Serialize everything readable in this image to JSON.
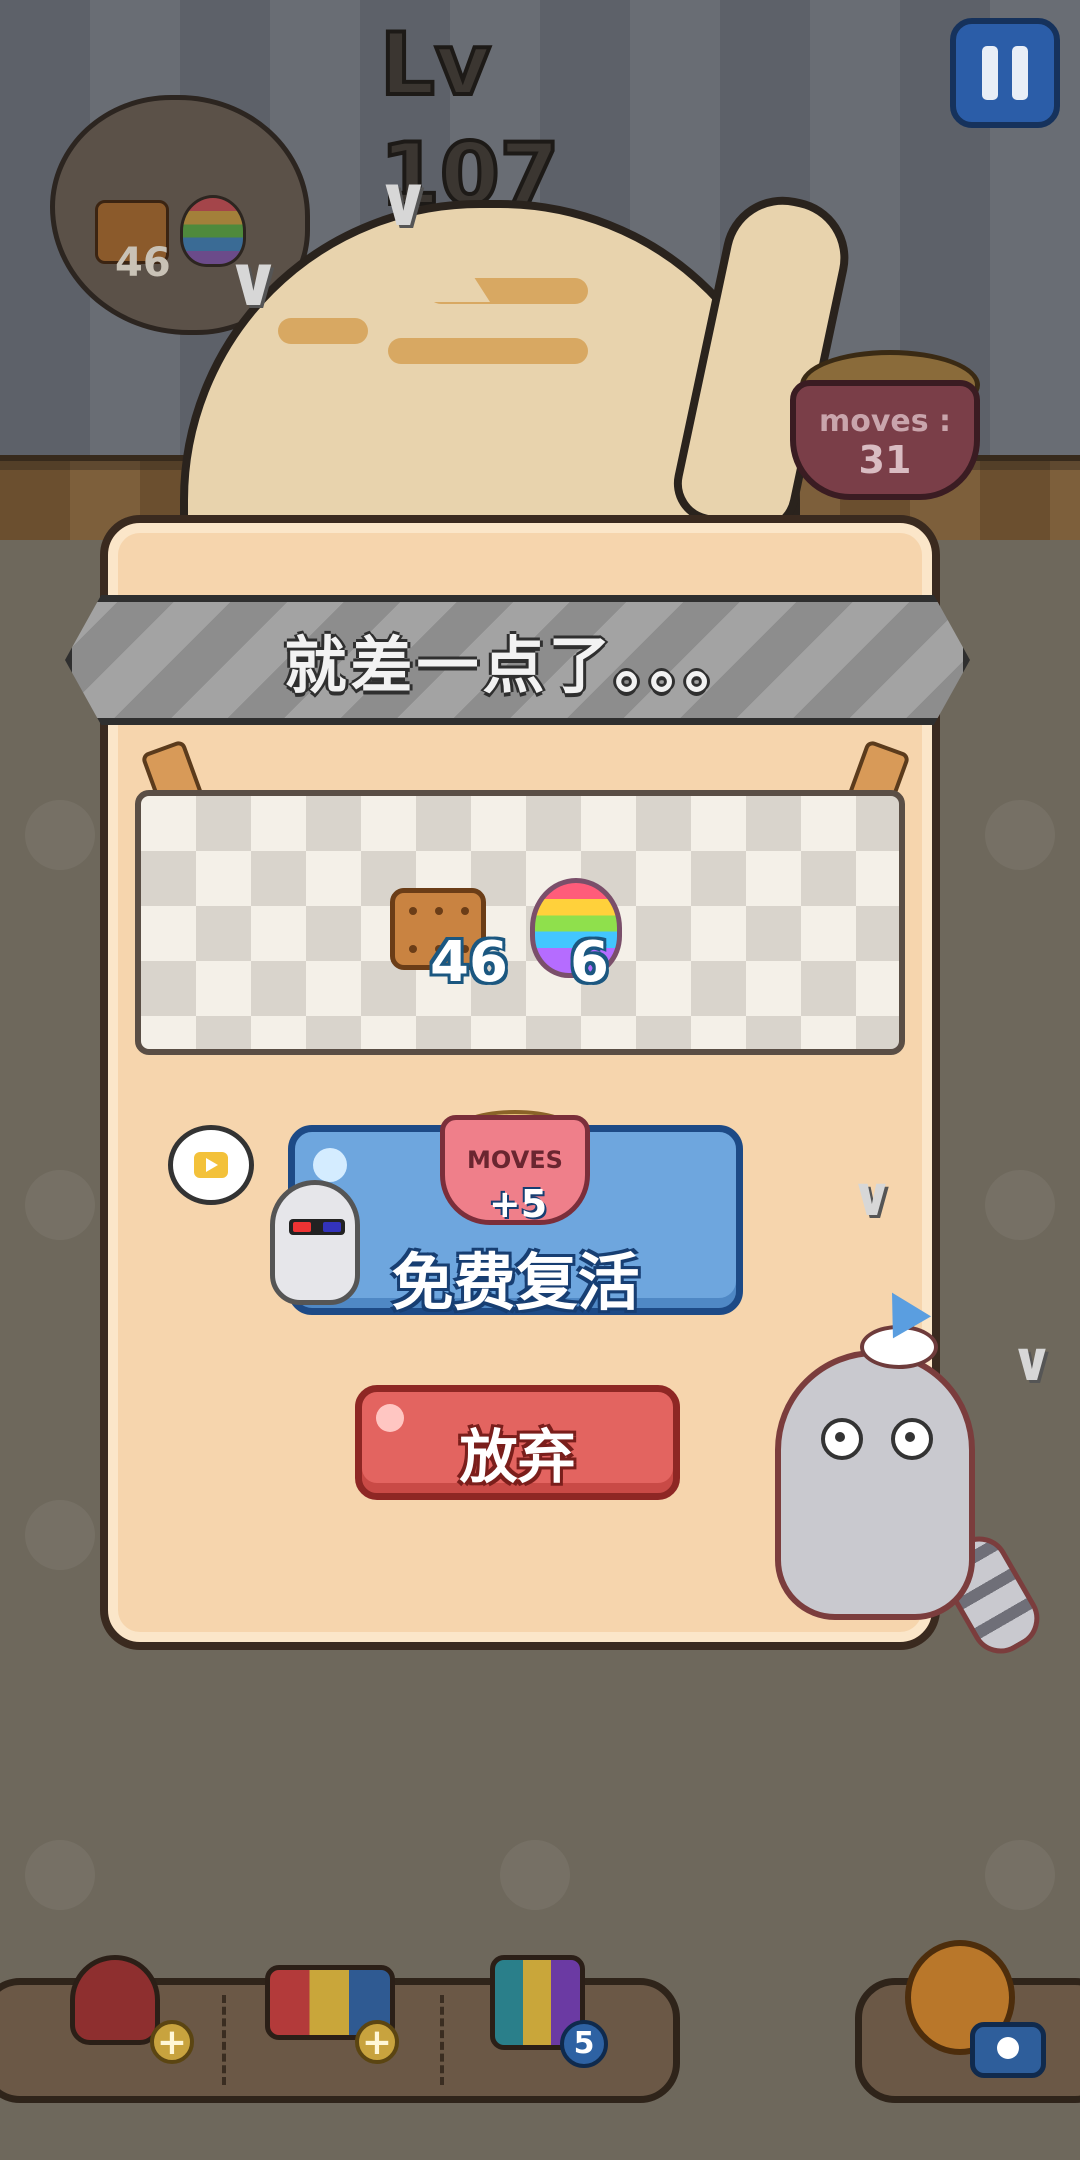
{
  "hud": {
    "level": "Lv 107",
    "pause_icon": "pause-icon",
    "thought_goal_count": "46"
  },
  "background": {
    "food_bowl_label": "moves :",
    "moves_left": "31"
  },
  "dialog": {
    "title": "就差一点了。。。",
    "goals": [
      {
        "icon": "biscuit-icon",
        "count": "46"
      },
      {
        "icon": "rainbow-jelly-icon",
        "count": "6"
      }
    ],
    "revive": {
      "bowl_label": "MOVES",
      "bonus": "+5",
      "label": "免费复活",
      "ad_icon": "video-ad-icon"
    },
    "give_up_label": "放弃"
  },
  "tools": [
    {
      "icon": "hammer-tool-icon",
      "badge": "+"
    },
    {
      "icon": "paint-roller-tool-icon",
      "badge": "+"
    },
    {
      "icon": "paint-brush-tool-icon",
      "badge": "5"
    },
    {
      "icon": "shuffle-tool-icon",
      "badge": ""
    }
  ],
  "colors": {
    "panel": "#f6d5ad",
    "revive_button": "#6ea6de",
    "give_up_button": "#e36460",
    "banner": "#a3a3a3"
  }
}
